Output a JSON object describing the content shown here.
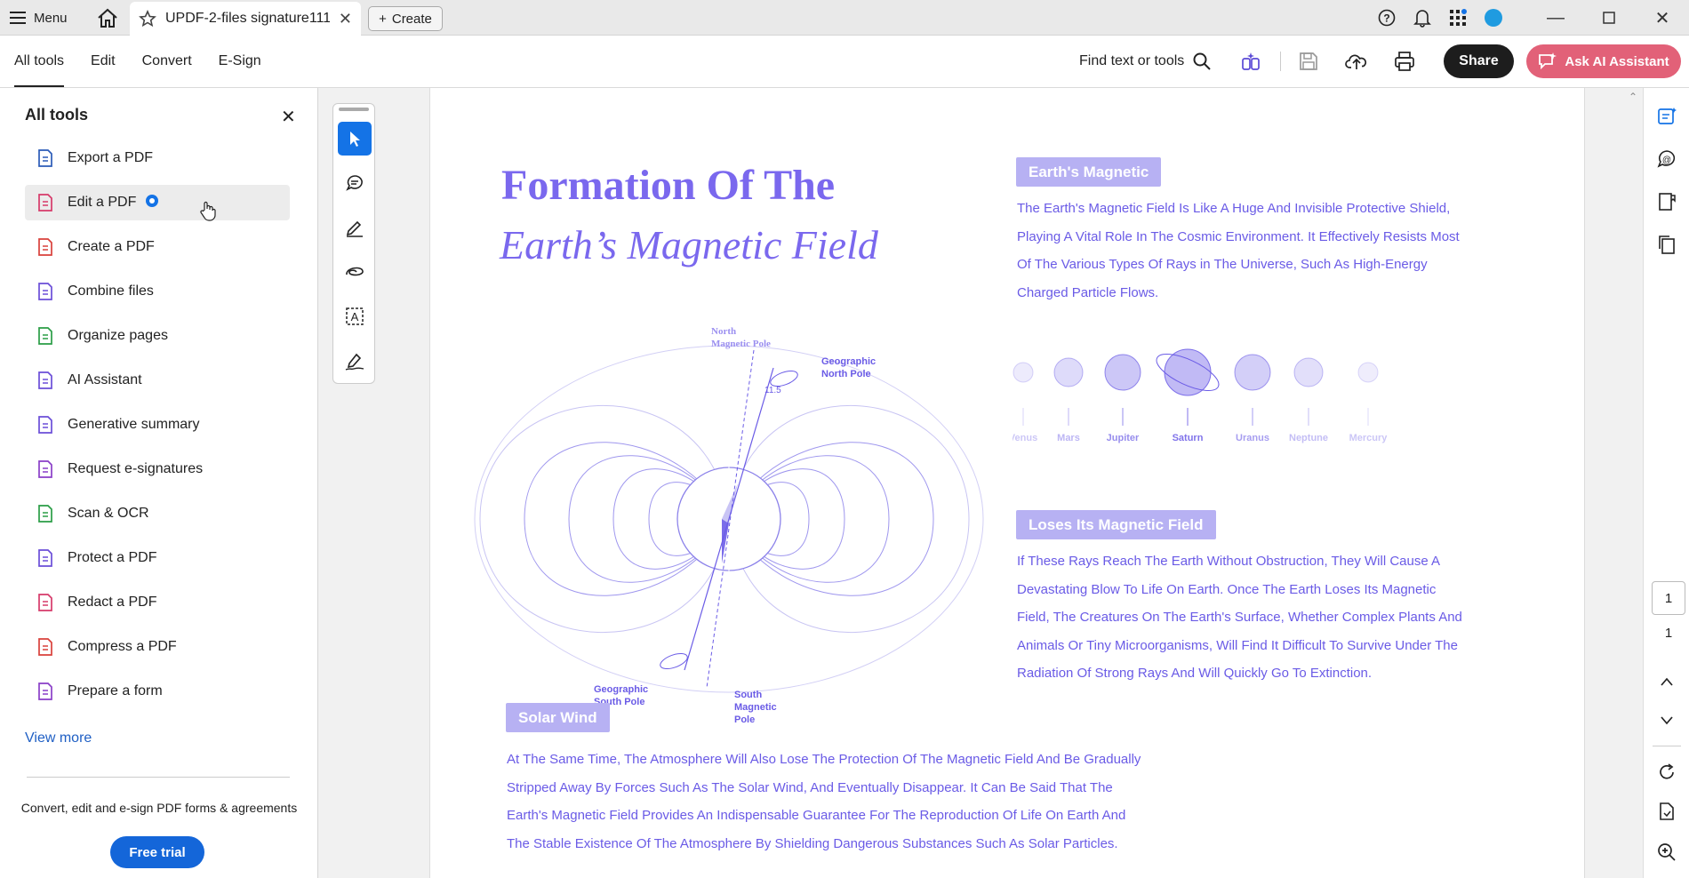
{
  "titlebar": {
    "menu_label": "Menu",
    "tab_title": "UPDF-2-files signature111...",
    "create_label": "Create",
    "accent": "#1473e6"
  },
  "toolbar": {
    "tabs": [
      "All tools",
      "Edit",
      "Convert",
      "E-Sign"
    ],
    "find_label": "Find text or tools",
    "share_label": "Share",
    "ai_label": "Ask AI Assistant"
  },
  "panel": {
    "title": "All tools",
    "items": [
      {
        "label": "Export a PDF",
        "icon": "export-pdf-icon",
        "color": "#2b5bb8"
      },
      {
        "label": "Edit a PDF",
        "icon": "edit-pdf-icon",
        "color": "#d63a6a"
      },
      {
        "label": "Create a PDF",
        "icon": "create-pdf-icon",
        "color": "#d9413b"
      },
      {
        "label": "Combine files",
        "icon": "combine-files-icon",
        "color": "#6b4ed8"
      },
      {
        "label": "Organize pages",
        "icon": "organize-pages-icon",
        "color": "#2a9d46"
      },
      {
        "label": "AI Assistant",
        "icon": "ai-assistant-icon",
        "color": "#6b4ed8"
      },
      {
        "label": "Generative summary",
        "icon": "generative-summary-icon",
        "color": "#6b4ed8"
      },
      {
        "label": "Request e-signatures",
        "icon": "request-esign-icon",
        "color": "#8a3fc8"
      },
      {
        "label": "Scan & OCR",
        "icon": "scan-ocr-icon",
        "color": "#2a9d46"
      },
      {
        "label": "Protect a PDF",
        "icon": "protect-pdf-icon",
        "color": "#6b4ed8"
      },
      {
        "label": "Redact a PDF",
        "icon": "redact-pdf-icon",
        "color": "#d63a6a"
      },
      {
        "label": "Compress a PDF",
        "icon": "compress-pdf-icon",
        "color": "#d9413b"
      },
      {
        "label": "Prepare a form",
        "icon": "prepare-form-icon",
        "color": "#8a3fc8"
      }
    ],
    "view_more": "View more",
    "promo": "Convert, edit and e-sign PDF forms & agreements",
    "trial_label": "Free trial"
  },
  "document": {
    "title_line1": "Formation Of The",
    "title_line2": "Earth’s Magnetic Field",
    "sections": [
      {
        "heading": "Earth's Magnetic",
        "lines": [
          "The Earth's Magnetic Field Is Like A Huge And Invisible Protective Shield,",
          "Playing A Vital Role In The Cosmic Environment. It Effectively Resists Most",
          "Of The Various Types Of Rays in The Universe, Such As High-Energy",
          "Charged Particle Flows."
        ]
      },
      {
        "heading": "Loses Its Magnetic Field",
        "lines": [
          "If These Rays Reach The Earth Without Obstruction, They Will Cause A",
          "Devastating Blow To Life On Earth. Once The Earth Loses Its Magnetic",
          "Field, The Creatures On The Earth's Surface, Whether Complex Plants And",
          "Animals Or Tiny Microorganisms, Will Find It Difficult To Survive Under The",
          "Radiation Of Strong Rays And Will Quickly Go To Extinction."
        ]
      },
      {
        "heading": "Solar Wind",
        "lines": [
          "At The Same Time, The Atmosphere Will Also Lose The Protection Of The Magnetic Field And Be Gradually",
          "Stripped Away By Forces Such As The Solar Wind, And Eventually Disappear. It Can Be Said That The",
          "Earth's Magnetic Field Provides An Indispensable Guarantee For The Reproduction Of Life On Earth And",
          "The Stable Existence Of The Atmosphere By Shielding Dangerous Substances Such As Solar Particles."
        ]
      }
    ],
    "diagram_labels": {
      "north_magnetic_pole": [
        "North",
        "Magnetic Pole"
      ],
      "geographic_north_pole": [
        "Geographic",
        "North Pole"
      ],
      "angle": "11.5",
      "geographic_south_pole": [
        "Geographic",
        "South Pole"
      ],
      "south_magnetic_pole": [
        "South",
        "Magnetic",
        "Pole"
      ]
    },
    "planets": [
      "Venus",
      "Mars",
      "Jupiter",
      "Saturn",
      "Uranus",
      "Neptune",
      "Mercury"
    ],
    "text_color": "#6a5be6",
    "chip_color": "#b7b1f3"
  },
  "pager": {
    "current": "1",
    "total": "1"
  }
}
